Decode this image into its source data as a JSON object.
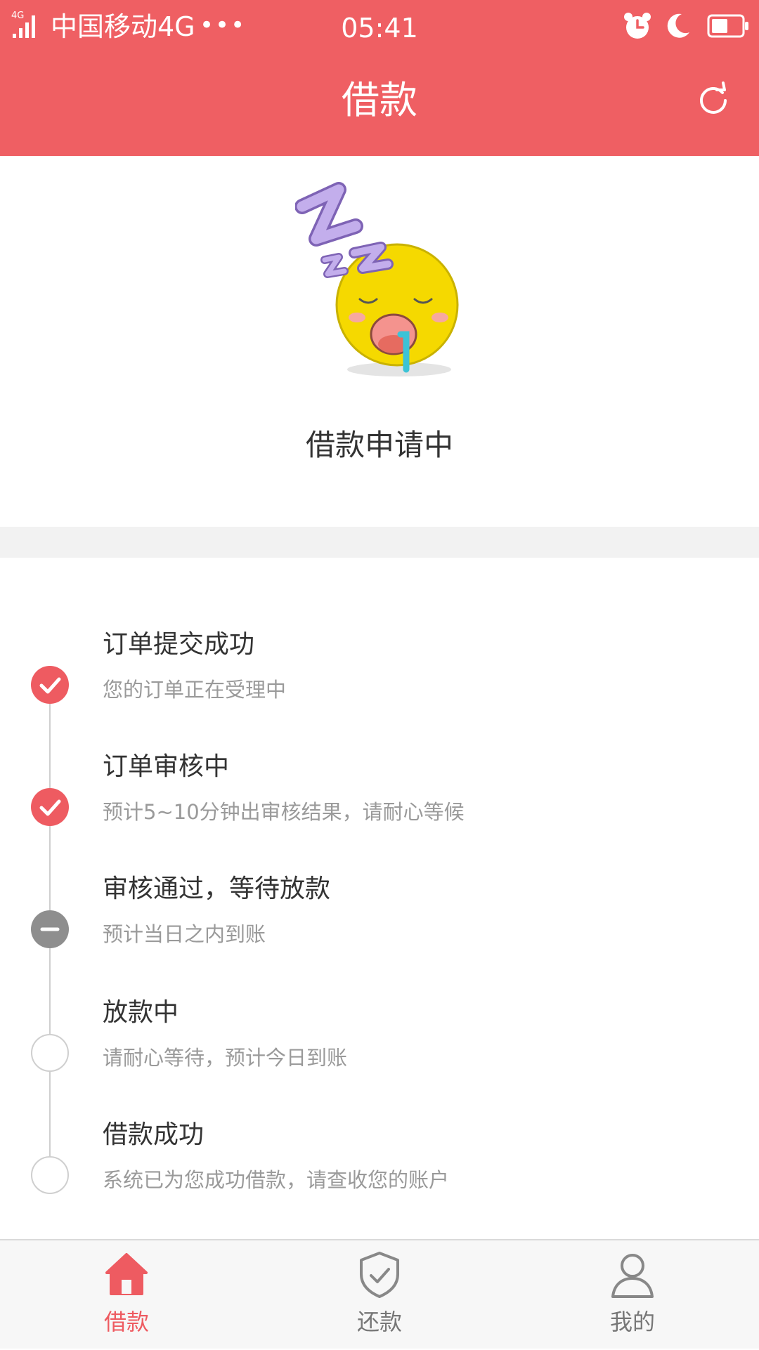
{
  "status_bar": {
    "network_type": "4G",
    "carrier": "中国移动4G",
    "more": "•••",
    "time": "05:41",
    "icons": [
      "signal-icon",
      "alarm-icon",
      "moon-icon",
      "battery-icon"
    ]
  },
  "header": {
    "title": "借款",
    "refresh_icon": "refresh-icon"
  },
  "hero": {
    "illustration": "sleeping-emoji-zzz",
    "status_text": "借款申请中"
  },
  "timeline": {
    "steps": [
      {
        "title": "订单提交成功",
        "desc": "您的订单正在受理中",
        "state": "done"
      },
      {
        "title": "订单审核中",
        "desc": "预计5~10分钟出审核结果，请耐心等候",
        "state": "done"
      },
      {
        "title": "审核通过，等待放款",
        "desc": "预计当日之内到账",
        "state": "current"
      },
      {
        "title": "放款中",
        "desc": "请耐心等待，预计今日到账",
        "state": "pending"
      },
      {
        "title": "借款成功",
        "desc": "系统已为您成功借款，请查收您的账户",
        "state": "pending"
      }
    ]
  },
  "tabbar": {
    "tabs": [
      {
        "label": "借款",
        "icon": "home-icon",
        "active": true
      },
      {
        "label": "还款",
        "icon": "shield-check-icon",
        "active": false
      },
      {
        "label": "我的",
        "icon": "user-icon",
        "active": false
      }
    ]
  },
  "colors": {
    "primary": "#EF5F63",
    "done": "#EE5B61",
    "current": "#8E8E8E",
    "line": "#CFCFCF",
    "secondary_text": "#9A9A9A"
  }
}
